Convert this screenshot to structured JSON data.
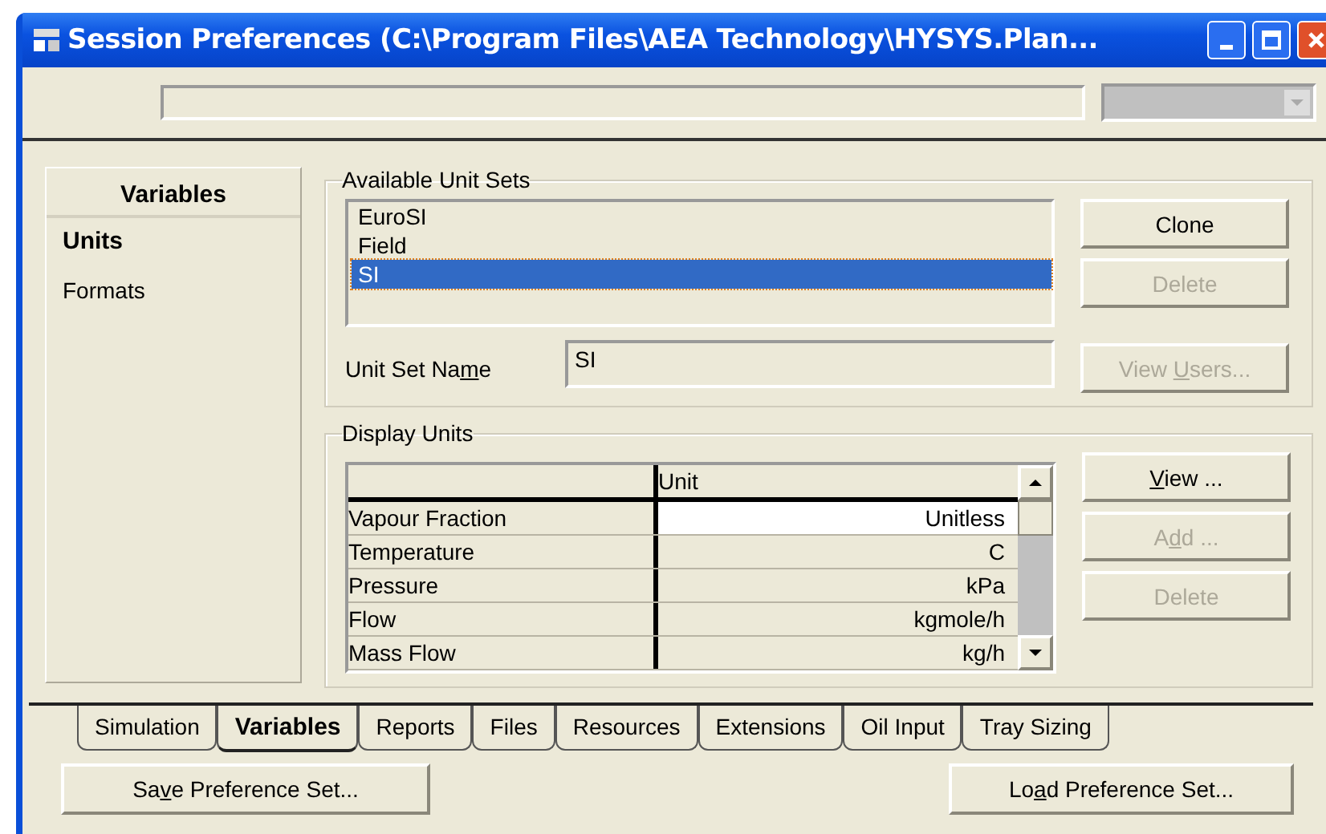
{
  "window": {
    "title": "Session Preferences (C:\\Program Files\\AEA Technology\\HYSYS.Plan..."
  },
  "sidebar": {
    "title": "Variables",
    "items": [
      {
        "label": "Units",
        "selected": true
      },
      {
        "label": "Formats",
        "selected": false
      }
    ]
  },
  "available_unit_sets": {
    "title": "Available Unit Sets",
    "items": [
      {
        "label": "EuroSI",
        "selected": false
      },
      {
        "label": "Field",
        "selected": false
      },
      {
        "label": "SI",
        "selected": true
      }
    ],
    "buttons": [
      {
        "label": {
          "before": "Clone"
        },
        "disabled": false
      },
      {
        "label": {
          "before": "Delete"
        },
        "disabled": true
      }
    ],
    "name_label": {
      "before": "Unit Set Na",
      "key": "m",
      "after": "e"
    },
    "name_value": "SI",
    "view_users": {
      "label": {
        "before": "View ",
        "key": "U",
        "after": "sers..."
      },
      "disabled": true
    }
  },
  "display_units": {
    "title": "Display Units",
    "columns": [
      "Unit"
    ],
    "rows": [
      {
        "name": "Vapour Fraction",
        "unit": "Unitless",
        "selected": true
      },
      {
        "name": "Temperature",
        "unit": "C",
        "selected": false
      },
      {
        "name": "Pressure",
        "unit": "kPa",
        "selected": false
      },
      {
        "name": "Flow",
        "unit": "kgmole/h",
        "selected": false
      },
      {
        "name": "Mass Flow",
        "unit": "kg/h",
        "selected": false
      }
    ],
    "buttons": [
      {
        "label": {
          "key": "V",
          "after": "iew ..."
        },
        "disabled": false
      },
      {
        "label": {
          "before": "A",
          "key": "d",
          "after": "d ..."
        },
        "disabled": true
      },
      {
        "label": {
          "before": "Delete"
        },
        "disabled": true
      }
    ]
  },
  "tabs": [
    {
      "label": "Simulation",
      "selected": false
    },
    {
      "label": "Variables",
      "selected": true
    },
    {
      "label": "Reports",
      "selected": false
    },
    {
      "label": "Files",
      "selected": false
    },
    {
      "label": "Resources",
      "selected": false
    },
    {
      "label": "Extensions",
      "selected": false
    },
    {
      "label": "Oil Input",
      "selected": false
    },
    {
      "label": "Tray Sizing",
      "selected": false
    }
  ],
  "footer_buttons": [
    {
      "label": {
        "before": "Sa",
        "key": "v",
        "after": "e Preference Set..."
      }
    },
    {
      "label": {
        "before": "Lo",
        "key": "a",
        "after": "d Preference Set..."
      }
    }
  ]
}
